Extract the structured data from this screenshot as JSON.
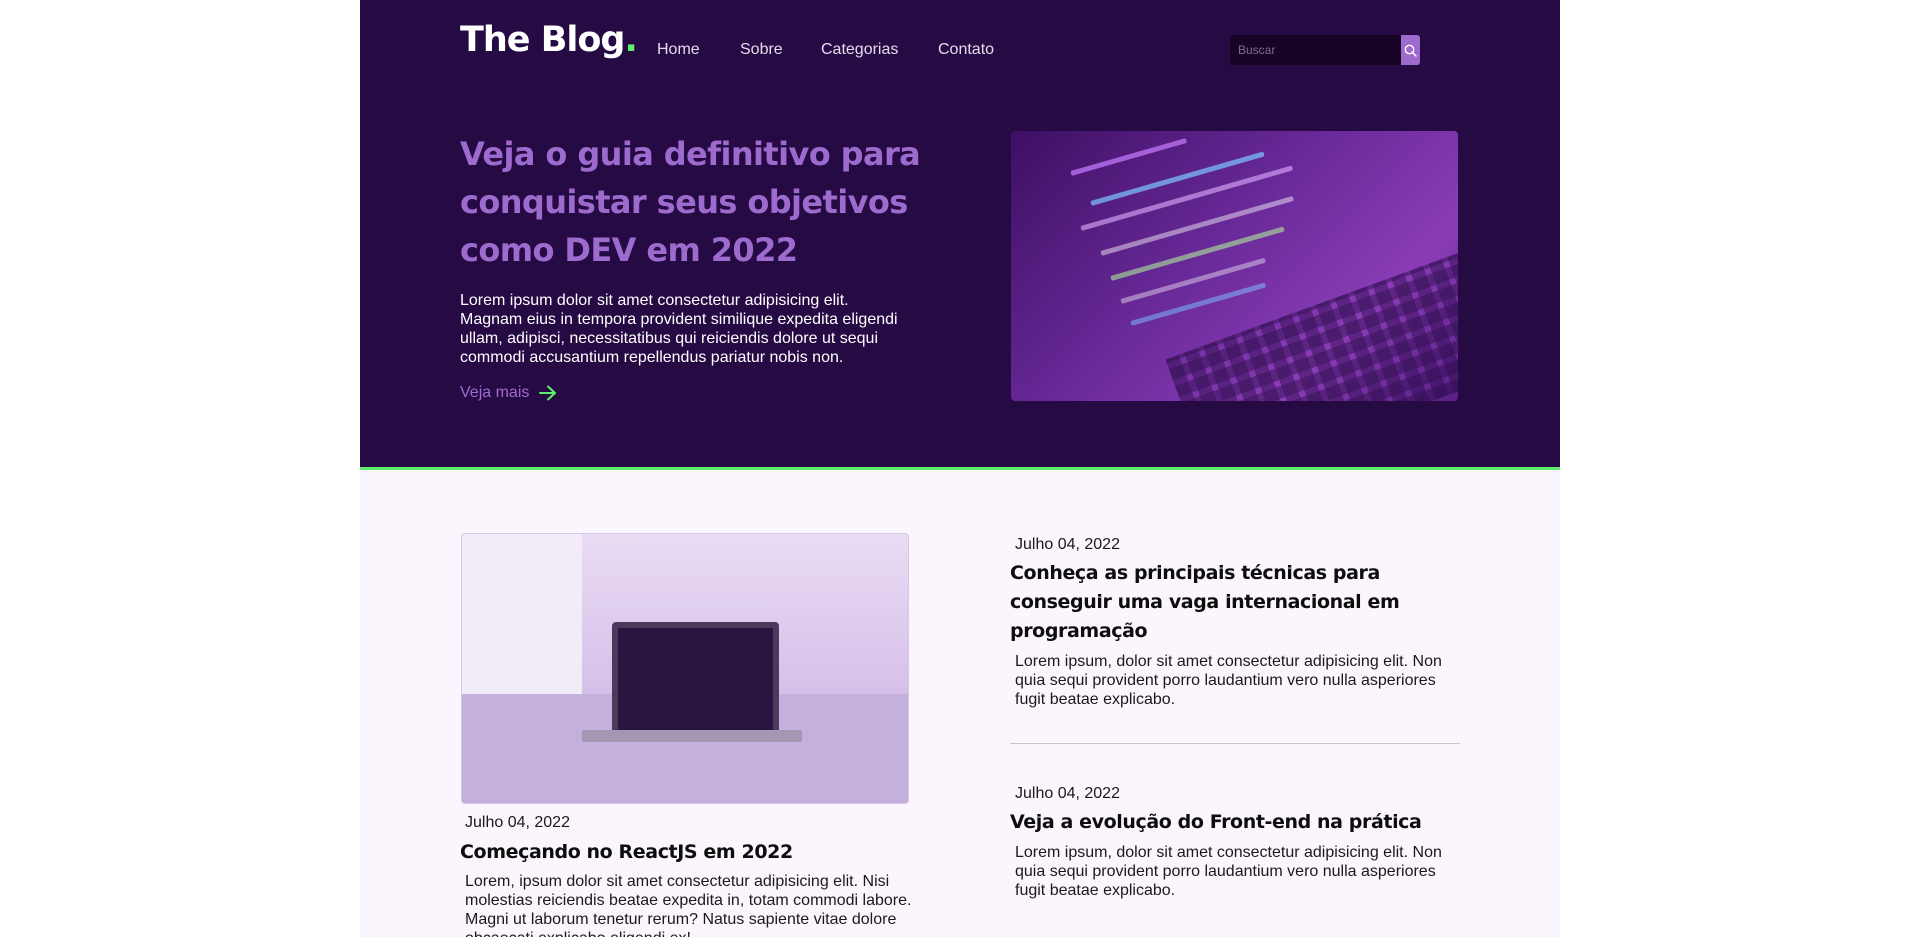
{
  "header": {
    "logo_text": "The Blog",
    "logo_dot": ".",
    "nav": [
      {
        "label": "Home"
      },
      {
        "label": "Sobre"
      },
      {
        "label": "Categorias"
      },
      {
        "label": "Contato"
      }
    ],
    "search": {
      "placeholder": "Buscar",
      "button_icon": "search-icon"
    }
  },
  "hero": {
    "title": "Veja o guia definitivo para conquistar seus objetivos como DEV em 2022",
    "text": "Lorem ipsum dolor sit amet consectetur adipisicing elit. Magnam eius in tempora provident similique expedita eligendi ullam, adipisci, necessitatibus qui reiciendis dolore ut sequi commodi accusantium repellendus pariatur nobis non.",
    "link_label": "Veja mais",
    "link_icon": "arrow-right-icon"
  },
  "featured_post": {
    "date": "Julho 04, 2022",
    "title": "Começando no ReactJS em 2022",
    "excerpt": "Lorem, ipsum dolor sit amet consectetur adipisicing elit. Nisi molestias reiciendis beatae expedita in, totam commodi labore. Magni ut laborum tenetur rerum? Natus sapiente vitae dolore obcaecati explicabo eligendi ex!"
  },
  "posts": [
    {
      "date": "Julho 04, 2022",
      "title": "Conheça as principais técnicas para conseguir uma vaga internacional em programação",
      "excerpt": "Lorem ipsum, dolor sit amet consectetur adipisicing elit. Non quia sequi provident porro laudantium vero nulla asperiores fugit beatae explicabo."
    },
    {
      "date": "Julho 04, 2022",
      "title": "Veja a evolução do Front-end na prática",
      "excerpt": "Lorem ipsum, dolor sit amet consectetur adipisicing elit. Non quia sequi provident porro laudantium vero nulla asperiores fugit beatae explicabo."
    }
  ],
  "colors": {
    "hero_bg": "#260a44",
    "accent_purple": "#9d6bce",
    "accent_green": "#5ef06c",
    "content_bg": "#fbf5fd"
  }
}
